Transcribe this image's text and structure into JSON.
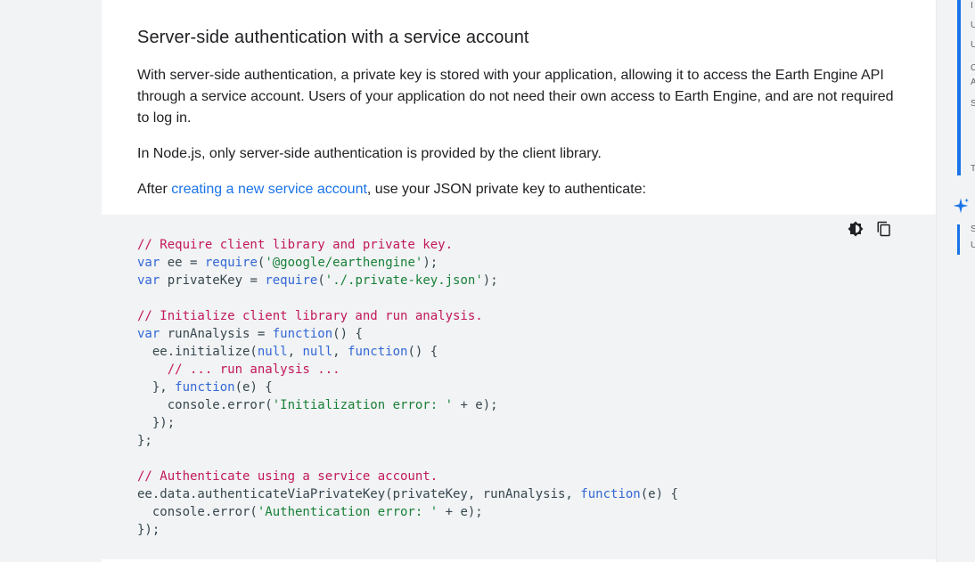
{
  "section": {
    "heading": "Server-side authentication with a service account",
    "p1": "With server-side authentication, a private key is stored with your application, allowing it to access the Earth Engine API through a service account. Users of your application do not need their own access to Earth Engine, and are not required to log in.",
    "p2": "In Node.js, only server-side authentication is provided by the client library.",
    "p3_before": "After ",
    "p3_link": "creating a new service account",
    "p3_after": ", use your JSON private key to authenticate:"
  },
  "code": {
    "lines": [
      [
        [
          "cm",
          "// Require client library and private key."
        ]
      ],
      [
        [
          "kw",
          "var"
        ],
        [
          "",
          " ee = "
        ],
        [
          "kw",
          "require"
        ],
        [
          "",
          "("
        ],
        [
          "st",
          "'@google/earthengine'"
        ],
        [
          "",
          ");"
        ]
      ],
      [
        [
          "kw",
          "var"
        ],
        [
          "",
          " privateKey = "
        ],
        [
          "kw",
          "require"
        ],
        [
          "",
          "("
        ],
        [
          "st",
          "'./.private-key.json'"
        ],
        [
          "",
          ");"
        ]
      ],
      [
        [
          "",
          ""
        ]
      ],
      [
        [
          "cm",
          "// Initialize client library and run analysis."
        ]
      ],
      [
        [
          "kw",
          "var"
        ],
        [
          "",
          " runAnalysis = "
        ],
        [
          "kw",
          "function"
        ],
        [
          "",
          "() {"
        ]
      ],
      [
        [
          "",
          "  ee.initialize("
        ],
        [
          "kw",
          "null"
        ],
        [
          "",
          ", "
        ],
        [
          "kw",
          "null"
        ],
        [
          "",
          ", "
        ],
        [
          "kw",
          "function"
        ],
        [
          "",
          "() {"
        ]
      ],
      [
        [
          "",
          "    "
        ],
        [
          "cm",
          "// ... run analysis ..."
        ]
      ],
      [
        [
          "",
          "  }, "
        ],
        [
          "kw",
          "function"
        ],
        [
          "",
          "(e) {"
        ]
      ],
      [
        [
          "",
          "    console.error("
        ],
        [
          "st",
          "'Initialization error: '"
        ],
        [
          "",
          " + e);"
        ]
      ],
      [
        [
          "",
          "  });"
        ]
      ],
      [
        [
          "",
          "};"
        ]
      ],
      [
        [
          "",
          ""
        ]
      ],
      [
        [
          "cm",
          "// Authenticate using a service account."
        ]
      ],
      [
        [
          "",
          "ee.data.authenticateViaPrivateKey(privateKey, runAnalysis, "
        ],
        [
          "kw",
          "function"
        ],
        [
          "",
          "(e) {"
        ]
      ],
      [
        [
          "",
          "  console.error("
        ],
        [
          "st",
          "'Authentication error: '"
        ],
        [
          "",
          " + e);"
        ]
      ],
      [
        [
          "",
          "});"
        ]
      ]
    ]
  },
  "toolbar": {
    "theme_icon": "dark-mode-icon",
    "copy_icon": "copy-icon"
  },
  "toc": {
    "letters": [
      "I",
      "U",
      "U",
      "C",
      "A",
      "S",
      "T",
      "S",
      "U"
    ]
  },
  "colors": {
    "link": "#1a73e8",
    "comment": "#c2185b",
    "keyword": "#3367d6",
    "string": "#188038",
    "code_bg": "#f1f3f4"
  }
}
